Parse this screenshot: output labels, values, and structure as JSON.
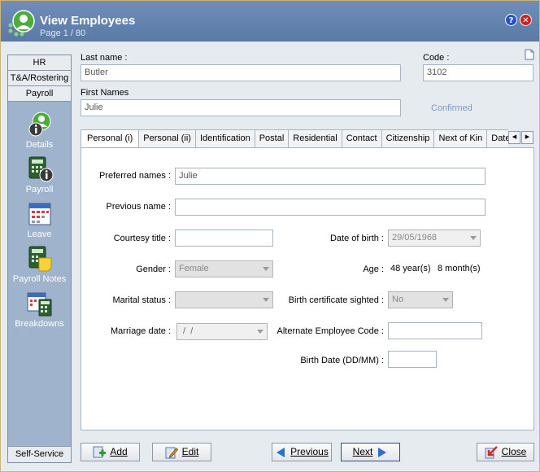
{
  "window": {
    "title": "View Employees",
    "subtitle": "Page 1 / 80",
    "help_glyph": "?",
    "close_glyph": "✕"
  },
  "sidebar": {
    "top_items": [
      {
        "label": "HR"
      },
      {
        "label": "T&A/Rostering"
      },
      {
        "label": "Payroll"
      }
    ],
    "items": [
      {
        "label": "Details",
        "icon": "employee-info-icon"
      },
      {
        "label": "Payroll",
        "icon": "calculator-icon"
      },
      {
        "label": "Leave",
        "icon": "calendar-icon"
      },
      {
        "label": "Payroll Notes",
        "icon": "calculator-notes-icon"
      },
      {
        "label": "Breakdowns",
        "icon": "calendar-calculator-icon"
      }
    ],
    "bottom_item": "Self-Service"
  },
  "header": {
    "last_name_label": "Last name :",
    "last_name": "Butler",
    "code_label": "Code :",
    "code": "3102",
    "first_names_label": "First Names",
    "first_names": "Julie",
    "status": "Confirmed"
  },
  "tabs": [
    {
      "label": "Personal (i)",
      "active": true
    },
    {
      "label": "Personal (ii)"
    },
    {
      "label": "Identification"
    },
    {
      "label": "Postal"
    },
    {
      "label": "Residential"
    },
    {
      "label": "Contact"
    },
    {
      "label": "Citizenship"
    },
    {
      "label": "Next of Kin"
    },
    {
      "label": "Dates"
    }
  ],
  "tab_nav": {
    "left": "◀",
    "right": "▶"
  },
  "form": {
    "preferred_names_label": "Preferred names :",
    "preferred_names": "Julie",
    "previous_name_label": "Previous name :",
    "previous_name": "",
    "courtesy_title_label": "Courtesy title :",
    "courtesy_title": "",
    "date_of_birth_label": "Date of birth :",
    "date_of_birth": "29/05/1968",
    "gender_label": "Gender :",
    "gender": "Female",
    "age_label": "Age :",
    "age_years": "48 year(s)",
    "age_months": "8 month(s)",
    "marital_status_label": "Marital status :",
    "marital_status": "",
    "birth_cert_label": "Birth certificate sighted :",
    "birth_cert": "No",
    "marriage_date_label": "Marriage date :",
    "marriage_date": " /  /",
    "alt_code_label": "Alternate Employee Code :",
    "alt_code": "",
    "birth_date_ddmm_label": "Birth Date (DD/MM) :",
    "birth_date_ddmm": ""
  },
  "buttons": {
    "add": {
      "label": "Add",
      "icon": "add-user-icon"
    },
    "edit": {
      "label": "Edit",
      "icon": "edit-pencil-icon"
    },
    "previous": {
      "label": "Previous",
      "icon": "arrow-left-icon"
    },
    "next": {
      "label": "Next",
      "icon": "arrow-right-icon"
    },
    "close": {
      "label": "Close",
      "icon": "close-arrow-icon"
    }
  },
  "colors": {
    "titlebar": "#5a7aa6",
    "sidebar": "#9fb3cd",
    "accent_blue": "#2b6fd1",
    "status_text": "#7a9cc8"
  }
}
